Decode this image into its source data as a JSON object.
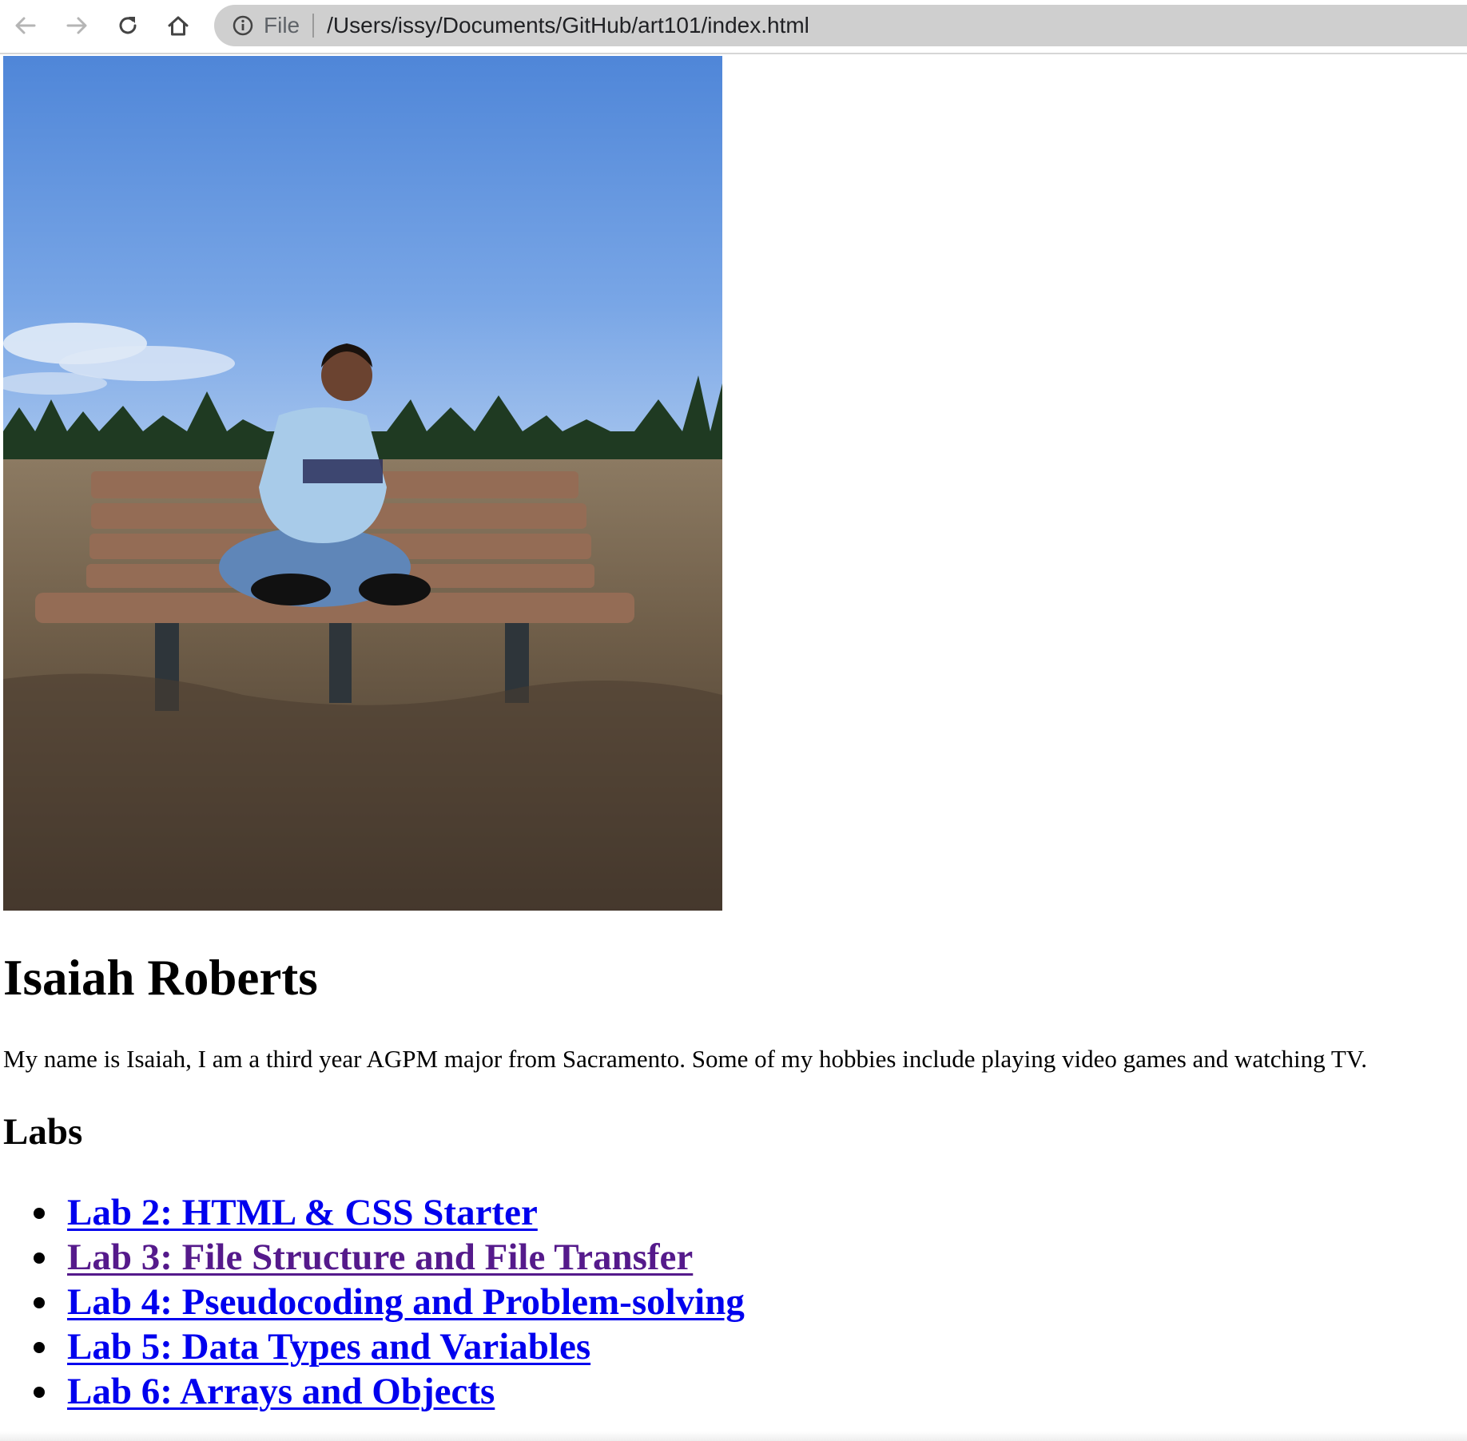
{
  "browser": {
    "url_scheme_label": "File",
    "url": "/Users/issy/Documents/GitHub/art101/index.html"
  },
  "page": {
    "photo_alt": "Photo of Isaiah sitting cross-legged on a wooden park bench in a grassy field",
    "name": "Isaiah Roberts",
    "bio": "My name is Isaiah, I am a third year AGPM major from Sacramento. Some of my hobbies include playing video games and watching TV.",
    "labs_heading": "Labs",
    "labs": [
      {
        "label": "Lab 2: HTML & CSS Starter",
        "visited": false
      },
      {
        "label": "Lab 3: File Structure and File Transfer",
        "visited": true
      },
      {
        "label": "Lab 4: Pseudocoding and Problem-solving",
        "visited": false
      },
      {
        "label": "Lab 5: Data Types and Variables",
        "visited": false
      },
      {
        "label": "Lab 6: Arrays and Objects",
        "visited": false
      }
    ]
  },
  "colors": {
    "link": "#0000ee",
    "visited_link": "#551a8b",
    "omnibox": "#cfcfcf"
  },
  "icons": {
    "back": "arrow-left-icon",
    "forward": "arrow-right-icon",
    "reload": "reload-icon",
    "home": "home-icon",
    "info": "info-circle-icon"
  }
}
